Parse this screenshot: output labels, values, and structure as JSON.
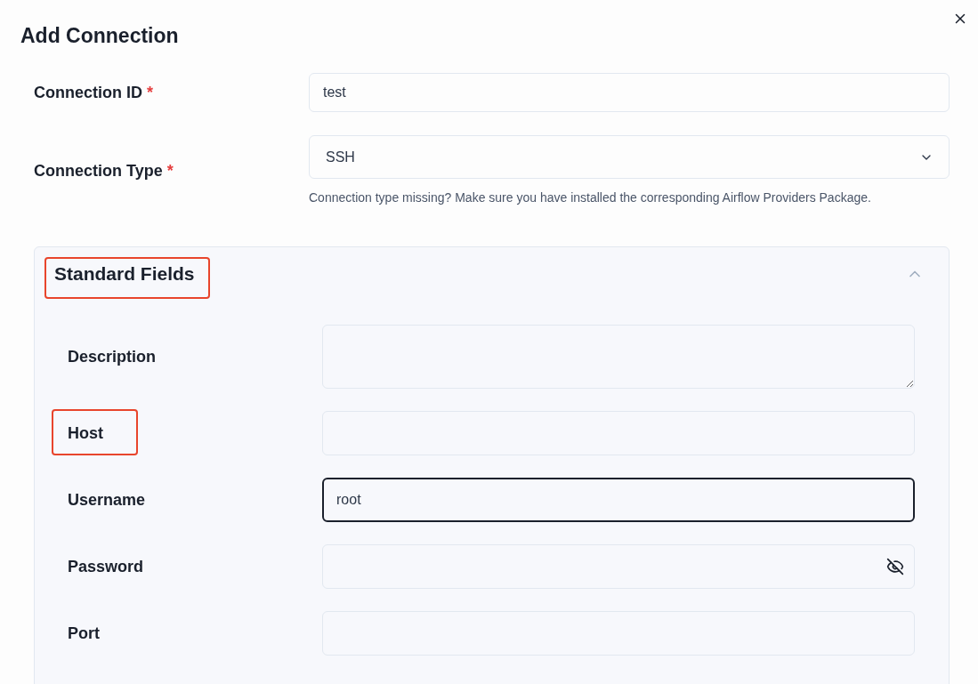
{
  "dialog": {
    "title": "Add Connection"
  },
  "fields": [
    {
      "kind": "text",
      "label": "Connection ID",
      "required_mark": "*",
      "value": "test"
    },
    {
      "kind": "select",
      "label": "Connection Type",
      "required_mark": "*",
      "value": "SSH",
      "hint": "Connection type missing? Make sure you have installed the corresponding Airflow Providers Package."
    }
  ],
  "section": {
    "title": "Standard Fields",
    "expanded": true,
    "highlighted": true,
    "fields": [
      {
        "kind": "textarea",
        "label": "Description",
        "highlighted": false,
        "focused": false
      },
      {
        "kind": "text",
        "label": "Host",
        "highlighted": true,
        "focused": false
      },
      {
        "kind": "text",
        "label": "Username",
        "value": "root",
        "highlighted": false,
        "focused": true
      },
      {
        "kind": "password",
        "label": "Password",
        "highlighted": false,
        "focused": false
      },
      {
        "kind": "text",
        "label": "Port",
        "highlighted": false,
        "focused": false
      }
    ]
  }
}
